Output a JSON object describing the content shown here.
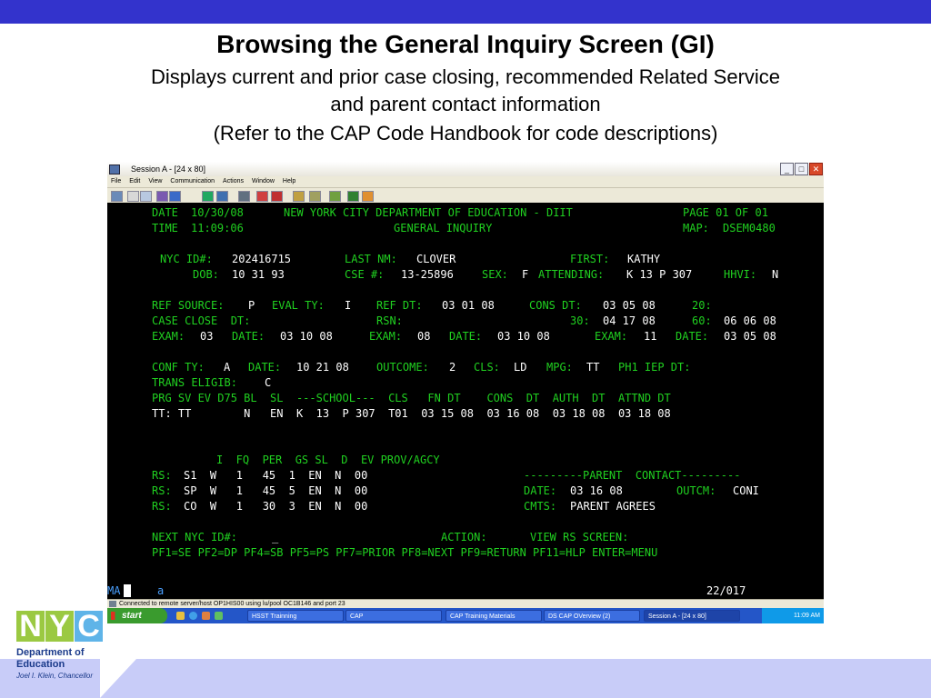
{
  "slide": {
    "title": "Browsing the General Inquiry Screen (GI)",
    "subtitle_lines": [
      "Displays current and prior case closing, recommended Related Service",
      "and parent contact information",
      "(Refer to the CAP Code Handbook for code descriptions)"
    ]
  },
  "window": {
    "title": "Session A - [24 x 80]",
    "menu": [
      "File",
      "Edit",
      "View",
      "Communication",
      "Actions",
      "Window",
      "Help"
    ]
  },
  "terminal": {
    "date_label": "DATE",
    "date": "10/30/08",
    "time_label": "TIME",
    "time": "11:09:06",
    "dept": "NEW YORK CITY DEPARTMENT OF EDUCATION - DIIT",
    "screen": "GENERAL INQUIRY",
    "page": "PAGE 01 OF 01",
    "map_label": "MAP:",
    "map": "DSEM0480",
    "nycid_label": "NYC ID#:",
    "nycid": "202416715",
    "lastnm_label": "LAST NM:",
    "lastnm": "CLOVER",
    "first_label": "FIRST:",
    "first": "KATHY",
    "dob_label": "DOB:",
    "dob": "10 31 93",
    "cse_label": "CSE #:",
    "cse": "13-25896",
    "sex_label": "SEX:",
    "sex": "F",
    "attending_label": "ATTENDING:",
    "attending": "K 13 P 307",
    "hhvi_label": "HHVI:",
    "hhvi": "N",
    "ref_source_label": "REF SOURCE:",
    "ref_source": "P",
    "eval_ty_label": "EVAL TY:",
    "eval_ty": "I",
    "ref_dt_label": "REF DT:",
    "ref_dt": "03 01 08",
    "cons_dt_label": "CONS DT:",
    "cons_dt": "03 05 08",
    "d20_label": "20:",
    "case_close_label": "CASE CLOSE  DT:",
    "rsn_label": "RSN:",
    "d30_label": "30:",
    "d30": "04 17 08",
    "d60_label": "60:",
    "d60": "06 06 08",
    "exam_label": "EXAM:",
    "date_lbl": "DATE:",
    "exam1": "03",
    "exam1_date": "03 10 08",
    "exam2": "08",
    "exam2_date": "03 10 08",
    "exam3": "11",
    "exam3_date": "03 05 08",
    "conf_ty_label": "CONF TY:",
    "conf_ty": "A",
    "conf_date": "10 21 08",
    "outcome_label": "OUTCOME:",
    "outcome": "2",
    "cls_label": "CLS:",
    "cls": "LD",
    "mpg_label": "MPG:",
    "mpg": "TT",
    "ph1_label": "PH1 IEP DT:",
    "trans_label": "TRANS ELIGIB:",
    "trans": "C",
    "prg_header": "PRG SV EV D75 BL  SL  ---SCHOOL---  CLS   FN DT    CONS  DT  AUTH  DT  ATTND DT",
    "tt_row": "TT: TT        N   EN  K  13  P 307  T01  03 15 08  03 16 08  03 18 08  03 18 08",
    "rs_header": "I  FQ  PER  GS SL  D  EV PROV/AGCY",
    "rs_label": "RS:",
    "rs_rows": [
      "S1  W   1   45  1  EN  N  00",
      "SP  W   1   45  5  EN  N  00",
      "CO  W   1   30  3  EN  N  00"
    ],
    "parent_header": "---------PARENT  CONTACT---------",
    "parent_date_label": "DATE:",
    "parent_date": "03 16 08",
    "outcm_label": "OUTCM:",
    "outcm": "CONI",
    "cmts_label": "CMTS:",
    "cmts": "PARENT AGREES",
    "next_label": "NEXT NYC ID#:",
    "next_value": "_",
    "action_label": "ACTION:",
    "view_label": "VIEW RS SCREEN:",
    "pf_keys": "PF1=SE PF2=DP PF4=SB PF5=PS PF7=PRIOR PF8=NEXT PF9=RETURN PF11=HLP ENTER=MENU"
  },
  "oia": {
    "ma": "MA",
    "a": "a",
    "cursor": "22/017"
  },
  "connection_status": "Connected to remote server/host OP1HIS00 using lu/pool OC1B146 and port 23",
  "taskbar": {
    "start": "start",
    "items": [
      "HSST Trainning",
      "CAP",
      "CAP Training Materials",
      "DS CAP OVerview (2)",
      "Session A - [24 x 80]"
    ],
    "clock": "11:09 AM"
  },
  "logo": {
    "letters": [
      "N",
      "Y",
      "C"
    ],
    "dept_lines": [
      "Department of",
      "Education"
    ],
    "chancellor": "Joel I. Klein, Chancellor"
  },
  "colors": {
    "top_bar": "#3333cc",
    "terminal_bg": "#000000",
    "terminal_label": "#20d020",
    "terminal_value": "#ffffff",
    "bottom_band": "#c8ccf8"
  }
}
